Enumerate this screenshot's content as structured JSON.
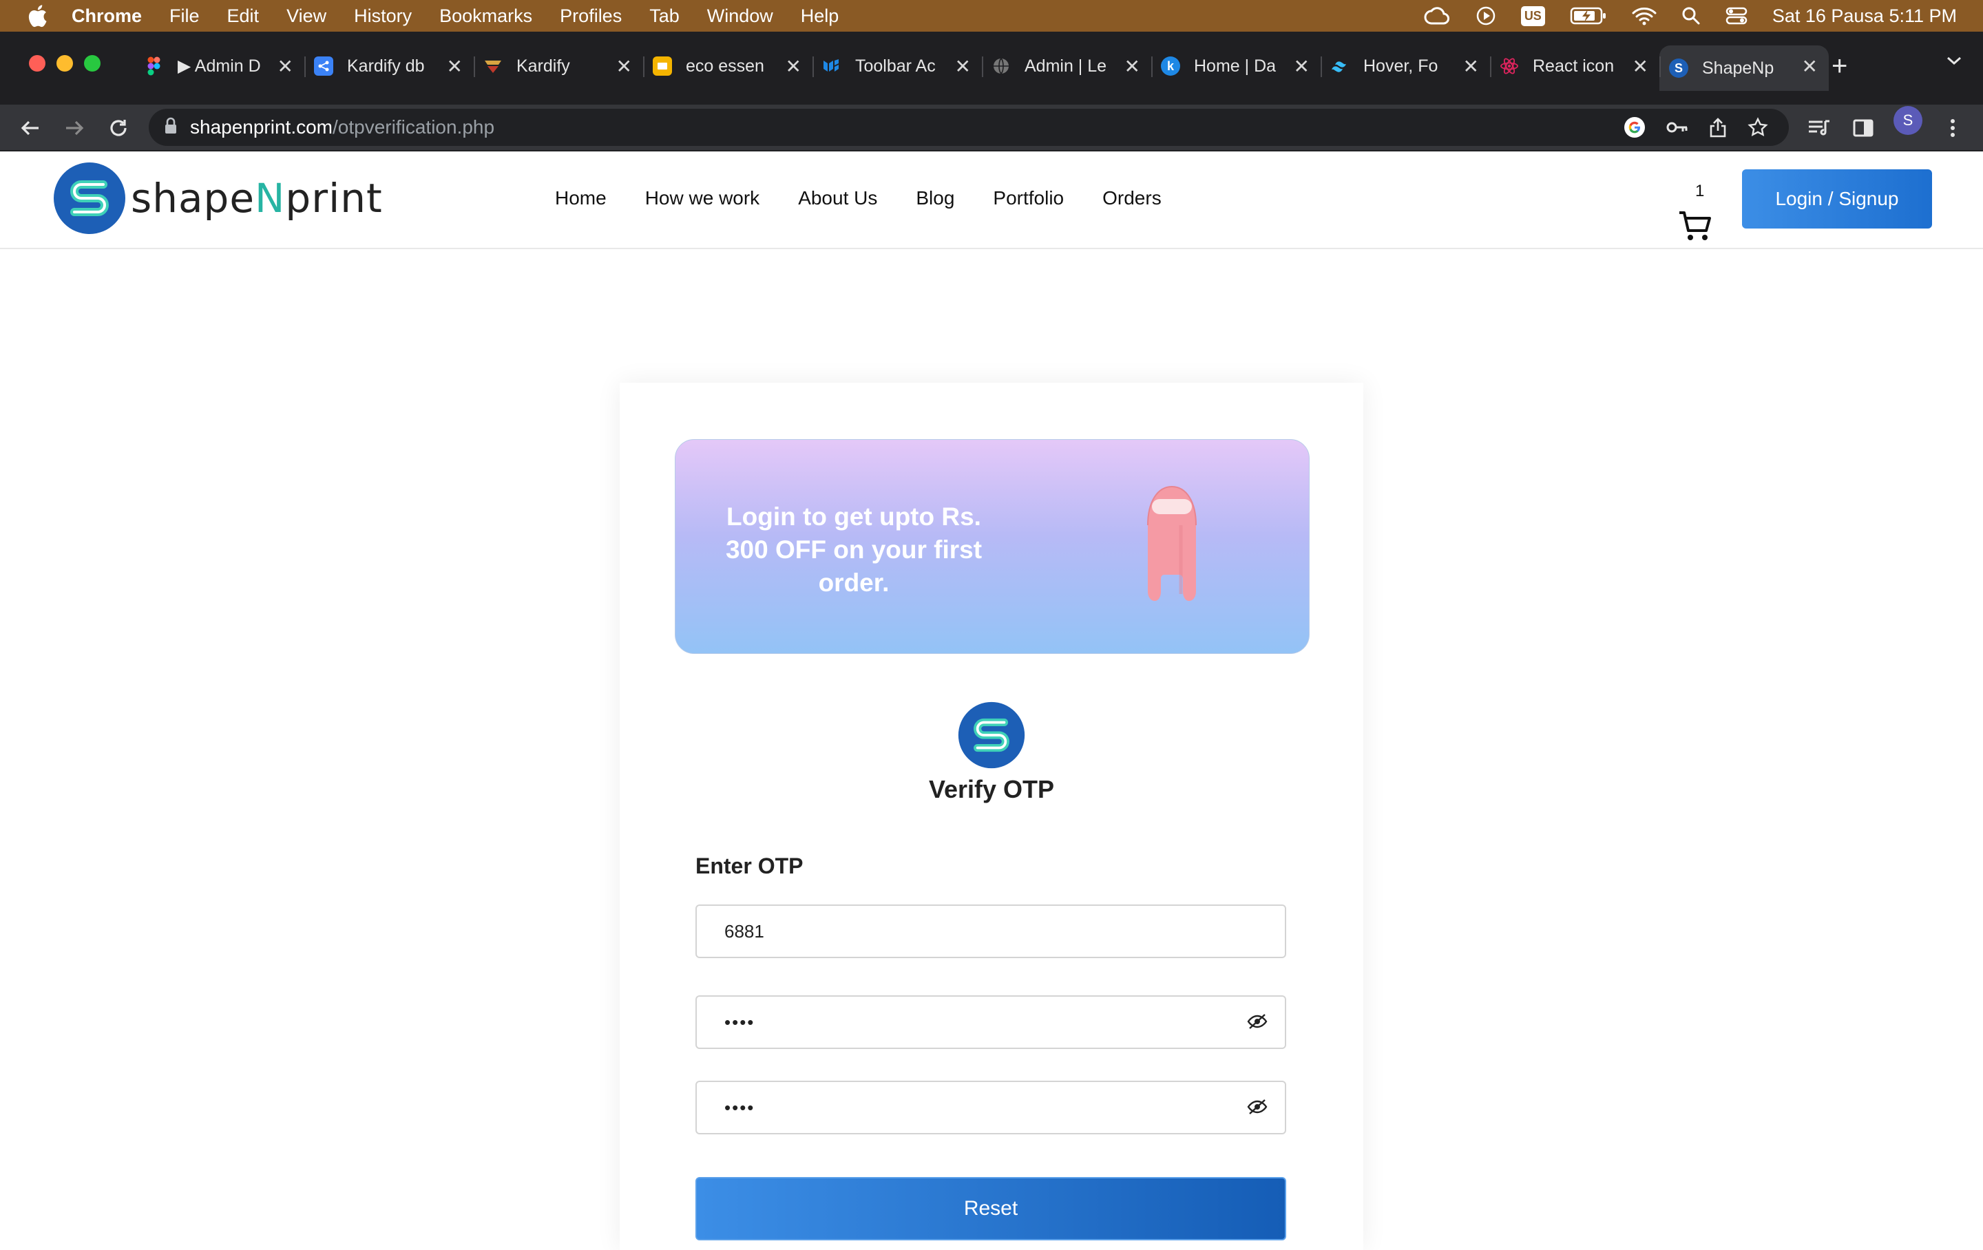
{
  "menubar": {
    "app": "Chrome",
    "items": [
      "File",
      "Edit",
      "View",
      "History",
      "Bookmarks",
      "Profiles",
      "Tab",
      "Window",
      "Help"
    ],
    "input_source": "US",
    "clock": "Sat 16 Pausa  5:11 PM"
  },
  "tabs": [
    {
      "title": "▶ Admin D",
      "icon": "figma-icon",
      "color": "#f24e1e"
    },
    {
      "title": "Kardify db",
      "icon": "share-icon",
      "color": "#3b82f6"
    },
    {
      "title": "Kardify",
      "icon": "kardify-icon",
      "color": "#d9a441"
    },
    {
      "title": "eco essen",
      "icon": "slides-icon",
      "color": "#f4b400"
    },
    {
      "title": "Toolbar Ac",
      "icon": "mui-icon",
      "color": "#1e88e5"
    },
    {
      "title": "Admin | Le",
      "icon": "globe-icon",
      "color": "#777777"
    },
    {
      "title": "Home | Da",
      "icon": "k-icon",
      "color": "#1e88e5"
    },
    {
      "title": "Hover, Fo",
      "icon": "tailwind-icon",
      "color": "#38bdf8"
    },
    {
      "title": "React icon",
      "icon": "react-icon",
      "color": "#e0245e"
    },
    {
      "title": "ShapeNpri",
      "icon": "shapenprint-icon",
      "color": "#1d5fb6"
    }
  ],
  "address_bar": {
    "domain": "shapenprint.com",
    "path": "/otpverification.php"
  },
  "profile_initial": "S",
  "site": {
    "logo_text_a": "shape",
    "logo_text_n": "N",
    "logo_text_b": "print",
    "nav": [
      "Home",
      "How we work",
      "About Us",
      "Blog",
      "Portfolio",
      "Orders"
    ],
    "cart_count": "1",
    "login_label": "Login / Signup"
  },
  "card": {
    "promo_text": "Login to get upto Rs. 300 OFF on your first order.",
    "title": "Verify OTP",
    "otp_label": "Enter OTP",
    "otp_value": "6881",
    "password_value": "••••",
    "confirm_value": "••••",
    "reset_label": "Reset"
  },
  "colors": {
    "accent": "#1d6fd0",
    "brand_teal": "#27b4a3",
    "menubar": "#8a5a25"
  }
}
